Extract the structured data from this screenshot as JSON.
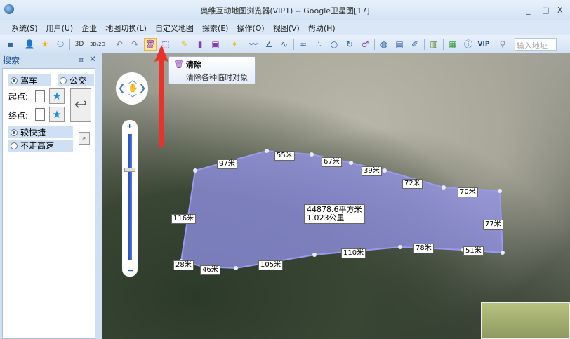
{
  "window": {
    "title": "奥维互动地图浏览器(VIP1) -- Google卫星图[17]",
    "minimize": "_",
    "maximize": "□",
    "close": "X"
  },
  "menu": [
    "系统(S)",
    "用户(U)",
    "企业",
    "地图切换(L)",
    "自定义地图",
    "探索(E)",
    "操作(O)",
    "视图(V)",
    "帮助(H)"
  ],
  "toolbar": {
    "search_placeholder": "输入地址",
    "label_3d": "3D",
    "label_3d2d": "3D/2D",
    "label_vip": "VIP"
  },
  "tooltip": {
    "title": "清除",
    "description": "清除各种临时对象"
  },
  "panel": {
    "title": "搜索",
    "pin": "ㅍ",
    "close": "✕",
    "drive": "驾车",
    "bus": "公交",
    "start": "起点:",
    "end": "终点:",
    "fast": "较快捷",
    "no_highway": "不走高速"
  },
  "map": {
    "area_label": "44878.6平方米",
    "length_label": "1.023公里",
    "segments": [
      "97米",
      "55米",
      "67米",
      "39米",
      "72米",
      "70米",
      "116米",
      "77米",
      "28米",
      "46米",
      "105米",
      "110米",
      "78米",
      "51米"
    ],
    "polygon_color": "#8c8cf0"
  }
}
